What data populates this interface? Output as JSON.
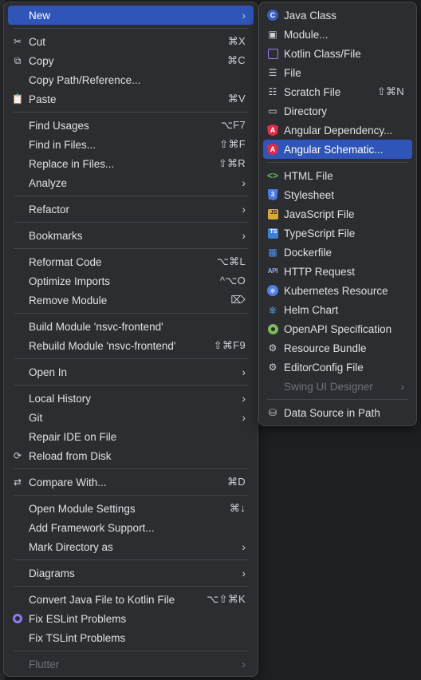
{
  "main_menu": {
    "items": [
      {
        "type": "item",
        "name": "menu-item-new",
        "label": "New",
        "icon": "",
        "shortcut": "",
        "submenu": true,
        "active": true
      },
      {
        "type": "sep"
      },
      {
        "type": "item",
        "name": "menu-item-cut",
        "label": "Cut",
        "icon": "scissors-icon",
        "glyph": "✂",
        "shortcut": "⌘X"
      },
      {
        "type": "item",
        "name": "menu-item-copy",
        "label": "Copy",
        "icon": "copy-icon",
        "glyph": "⧉",
        "shortcut": "⌘C"
      },
      {
        "type": "item",
        "name": "menu-item-copy-path",
        "label": "Copy Path/Reference...",
        "shortcut": ""
      },
      {
        "type": "item",
        "name": "menu-item-paste",
        "label": "Paste",
        "icon": "clipboard-icon",
        "glyph": "📋",
        "shortcut": "⌘V"
      },
      {
        "type": "sep"
      },
      {
        "type": "item",
        "name": "menu-item-find-usages",
        "label": "Find Usages",
        "shortcut": "⌥F7"
      },
      {
        "type": "item",
        "name": "menu-item-find-in-files",
        "label": "Find in Files...",
        "shortcut": "⇧⌘F"
      },
      {
        "type": "item",
        "name": "menu-item-replace-in-files",
        "label": "Replace in Files...",
        "shortcut": "⇧⌘R"
      },
      {
        "type": "item",
        "name": "menu-item-analyze",
        "label": "Analyze",
        "submenu": true
      },
      {
        "type": "sep"
      },
      {
        "type": "item",
        "name": "menu-item-refactor",
        "label": "Refactor",
        "submenu": true
      },
      {
        "type": "sep"
      },
      {
        "type": "item",
        "name": "menu-item-bookmarks",
        "label": "Bookmarks",
        "submenu": true
      },
      {
        "type": "sep"
      },
      {
        "type": "item",
        "name": "menu-item-reformat-code",
        "label": "Reformat Code",
        "shortcut": "⌥⌘L"
      },
      {
        "type": "item",
        "name": "menu-item-optimize-imports",
        "label": "Optimize Imports",
        "shortcut": "^⌥O"
      },
      {
        "type": "item",
        "name": "menu-item-remove-module",
        "label": "Remove Module",
        "shortcut": "⌦"
      },
      {
        "type": "sep"
      },
      {
        "type": "item",
        "name": "menu-item-build-module",
        "label": "Build Module 'nsvc-frontend'",
        "shortcut": ""
      },
      {
        "type": "item",
        "name": "menu-item-rebuild-module",
        "label": "Rebuild Module 'nsvc-frontend'",
        "shortcut": "⇧⌘F9"
      },
      {
        "type": "sep"
      },
      {
        "type": "item",
        "name": "menu-item-open-in",
        "label": "Open In",
        "submenu": true
      },
      {
        "type": "sep"
      },
      {
        "type": "item",
        "name": "menu-item-local-history",
        "label": "Local History",
        "submenu": true
      },
      {
        "type": "item",
        "name": "menu-item-git",
        "label": "Git",
        "submenu": true
      },
      {
        "type": "item",
        "name": "menu-item-repair-ide",
        "label": "Repair IDE on File",
        "shortcut": ""
      },
      {
        "type": "item",
        "name": "menu-item-reload-from-disk",
        "label": "Reload from Disk",
        "icon": "reload-icon",
        "glyph": "⟳",
        "shortcut": ""
      },
      {
        "type": "sep"
      },
      {
        "type": "item",
        "name": "menu-item-compare-with",
        "label": "Compare With...",
        "icon": "compare-icon",
        "glyph": "⇄",
        "shortcut": "⌘D"
      },
      {
        "type": "sep"
      },
      {
        "type": "item",
        "name": "menu-item-open-module-settings",
        "label": "Open Module Settings",
        "shortcut": "⌘↓"
      },
      {
        "type": "item",
        "name": "menu-item-add-framework-support",
        "label": "Add Framework Support...",
        "shortcut": ""
      },
      {
        "type": "item",
        "name": "menu-item-mark-directory-as",
        "label": "Mark Directory as",
        "submenu": true
      },
      {
        "type": "sep"
      },
      {
        "type": "item",
        "name": "menu-item-diagrams",
        "label": "Diagrams",
        "submenu": true
      },
      {
        "type": "sep"
      },
      {
        "type": "item",
        "name": "menu-item-convert-java-to-kotlin",
        "label": "Convert Java File to Kotlin File",
        "shortcut": "⌥⇧⌘K"
      },
      {
        "type": "item",
        "name": "menu-item-fix-eslint",
        "label": "Fix ESLint Problems",
        "icon": "eslint-icon",
        "iconClass": "ic-eslint",
        "shortcut": ""
      },
      {
        "type": "item",
        "name": "menu-item-fix-tslint",
        "label": "Fix TSLint Problems",
        "shortcut": ""
      },
      {
        "type": "sep"
      },
      {
        "type": "item",
        "name": "menu-item-flutter",
        "label": "Flutter",
        "submenu": true,
        "disabled": true
      }
    ]
  },
  "sub_menu": {
    "items": [
      {
        "type": "item",
        "name": "submenu-item-java-class",
        "label": "Java Class",
        "icon": "java-class-icon",
        "iconClass": "ic-java",
        "glyph": "C"
      },
      {
        "type": "item",
        "name": "submenu-item-module",
        "label": "Module...",
        "icon": "module-folder-icon",
        "glyph": "▣"
      },
      {
        "type": "item",
        "name": "submenu-item-kotlin-class",
        "label": "Kotlin Class/File",
        "icon": "kotlin-icon",
        "iconClass": "ic-kotlin",
        "glyph": ""
      },
      {
        "type": "item",
        "name": "submenu-item-file",
        "label": "File",
        "icon": "file-icon",
        "glyph": "☰"
      },
      {
        "type": "item",
        "name": "submenu-item-scratch-file",
        "label": "Scratch File",
        "icon": "scratch-file-icon",
        "glyph": "☷",
        "shortcut": "⇧⌘N"
      },
      {
        "type": "item",
        "name": "submenu-item-directory",
        "label": "Directory",
        "icon": "folder-icon",
        "glyph": "▭"
      },
      {
        "type": "item",
        "name": "submenu-item-angular-dependency",
        "label": "Angular Dependency...",
        "icon": "angular-icon",
        "iconClass": "ic-angular",
        "glyph": "A"
      },
      {
        "type": "item",
        "name": "submenu-item-angular-schematic",
        "label": "Angular Schematic...",
        "icon": "angular-icon",
        "iconClass": "ic-angular",
        "glyph": "A",
        "active": true
      },
      {
        "type": "sep"
      },
      {
        "type": "item",
        "name": "submenu-item-html-file",
        "label": "HTML File",
        "icon": "html-icon",
        "iconClass": "ic-html",
        "glyph": "<>"
      },
      {
        "type": "item",
        "name": "submenu-item-stylesheet",
        "label": "Stylesheet",
        "icon": "css-icon",
        "iconClass": "ic-css",
        "glyph": "3"
      },
      {
        "type": "item",
        "name": "submenu-item-javascript-file",
        "label": "JavaScript File",
        "icon": "javascript-icon",
        "iconClass": "ic-js",
        "glyph": "JS"
      },
      {
        "type": "item",
        "name": "submenu-item-typescript-file",
        "label": "TypeScript File",
        "icon": "typescript-icon",
        "iconClass": "ic-ts",
        "glyph": "TS"
      },
      {
        "type": "item",
        "name": "submenu-item-dockerfile",
        "label": "Dockerfile",
        "icon": "docker-icon",
        "iconClass": "ic-docker",
        "glyph": "▦"
      },
      {
        "type": "item",
        "name": "submenu-item-http-request",
        "label": "HTTP Request",
        "icon": "api-icon",
        "iconClass": "ic-api",
        "glyph": "API"
      },
      {
        "type": "item",
        "name": "submenu-item-kubernetes-resource",
        "label": "Kubernetes Resource",
        "icon": "kubernetes-icon",
        "iconClass": "ic-k8s",
        "glyph": "⎈"
      },
      {
        "type": "item",
        "name": "submenu-item-helm-chart",
        "label": "Helm Chart",
        "icon": "helm-icon",
        "iconClass": "ic-helm",
        "glyph": "⎈"
      },
      {
        "type": "item",
        "name": "submenu-item-openapi-spec",
        "label": "OpenAPI Specification",
        "icon": "openapi-icon",
        "iconClass": "ic-openapi",
        "glyph": ""
      },
      {
        "type": "item",
        "name": "submenu-item-resource-bundle",
        "label": "Resource Bundle",
        "icon": "gear-icon",
        "glyph": "⚙"
      },
      {
        "type": "item",
        "name": "submenu-item-editorconfig-file",
        "label": "EditorConfig File",
        "icon": "gear-icon",
        "glyph": "⚙"
      },
      {
        "type": "item",
        "name": "submenu-item-swing-ui-designer",
        "label": "Swing UI Designer",
        "submenu": true,
        "disabled": true
      },
      {
        "type": "sep"
      },
      {
        "type": "item",
        "name": "submenu-item-data-source-in-path",
        "label": "Data Source in Path",
        "icon": "database-icon",
        "glyph": "⛁"
      }
    ]
  },
  "colors": {
    "accent": "#2e55b7",
    "menu_bg": "#2b2d30",
    "text": "#dfe1e5",
    "disabled_text": "#6f737a"
  },
  "submenu_arrow": "›"
}
